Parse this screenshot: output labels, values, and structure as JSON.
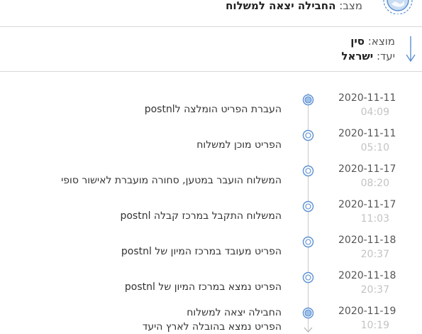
{
  "status": {
    "label": "מצב:",
    "value": "החבילה יצאה למשלוח"
  },
  "route": {
    "origin_label": "מוצא:",
    "origin_value": "סין",
    "dest_label": "יעד:",
    "dest_value": "ישראל"
  },
  "events": [
    {
      "date": "2020-11-11",
      "time": "04:09",
      "lines": [
        "העברת הפריט הומלצה לpostnl"
      ],
      "dot": "filled"
    },
    {
      "date": "2020-11-11",
      "time": "05:10",
      "lines": [
        "הפריט מוכן למשלוח"
      ],
      "dot": "outline"
    },
    {
      "date": "2020-11-17",
      "time": "08:20",
      "lines": [
        "המשלוח הועבר במטען, סחורה מועברת לאישור סופי"
      ],
      "dot": "outline"
    },
    {
      "date": "2020-11-17",
      "time": "11:03",
      "lines": [
        "המשלוח התקבל במרכז קבלה postnl"
      ],
      "dot": "outline"
    },
    {
      "date": "2020-11-18",
      "time": "20:37",
      "lines": [
        "הפריט מעובד במרכז המיון של postnl"
      ],
      "dot": "outline"
    },
    {
      "date": "2020-11-18",
      "time": "20:37",
      "lines": [
        "הפריט נמצא במרכז המיון של postnl"
      ],
      "dot": "outline"
    },
    {
      "date": "2020-11-19",
      "time": "10:19",
      "lines": [
        "החבילה יצאה למשלוח",
        "הפריט נמצא בהובלה לארץ היעד"
      ],
      "dot": "filled"
    }
  ],
  "colors": {
    "accent": "#5b8fd0",
    "accent_fill": "#9dc0ea",
    "muted": "#c3c3c3",
    "divider": "#d9d9d9"
  }
}
